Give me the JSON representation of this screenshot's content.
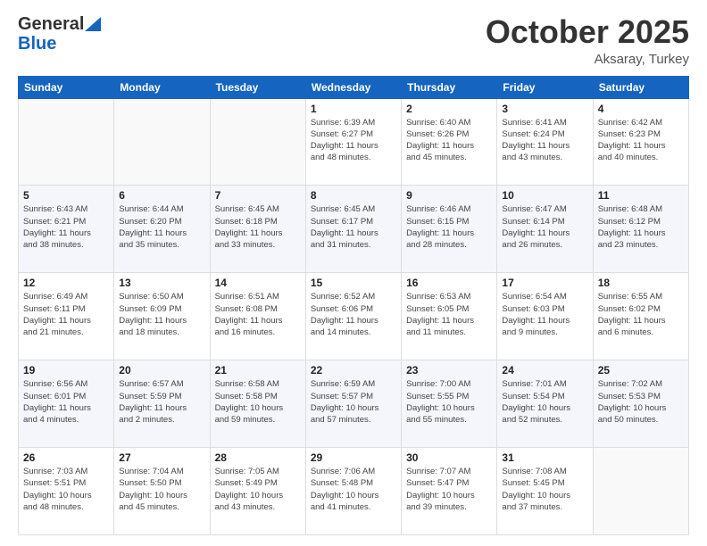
{
  "header": {
    "logo_general": "General",
    "logo_blue": "Blue",
    "month": "October 2025",
    "location": "Aksaray, Turkey"
  },
  "weekdays": [
    "Sunday",
    "Monday",
    "Tuesday",
    "Wednesday",
    "Thursday",
    "Friday",
    "Saturday"
  ],
  "weeks": [
    [
      {
        "day": "",
        "info": ""
      },
      {
        "day": "",
        "info": ""
      },
      {
        "day": "",
        "info": ""
      },
      {
        "day": "1",
        "info": "Sunrise: 6:39 AM\nSunset: 6:27 PM\nDaylight: 11 hours\nand 48 minutes."
      },
      {
        "day": "2",
        "info": "Sunrise: 6:40 AM\nSunset: 6:26 PM\nDaylight: 11 hours\nand 45 minutes."
      },
      {
        "day": "3",
        "info": "Sunrise: 6:41 AM\nSunset: 6:24 PM\nDaylight: 11 hours\nand 43 minutes."
      },
      {
        "day": "4",
        "info": "Sunrise: 6:42 AM\nSunset: 6:23 PM\nDaylight: 11 hours\nand 40 minutes."
      }
    ],
    [
      {
        "day": "5",
        "info": "Sunrise: 6:43 AM\nSunset: 6:21 PM\nDaylight: 11 hours\nand 38 minutes."
      },
      {
        "day": "6",
        "info": "Sunrise: 6:44 AM\nSunset: 6:20 PM\nDaylight: 11 hours\nand 35 minutes."
      },
      {
        "day": "7",
        "info": "Sunrise: 6:45 AM\nSunset: 6:18 PM\nDaylight: 11 hours\nand 33 minutes."
      },
      {
        "day": "8",
        "info": "Sunrise: 6:45 AM\nSunset: 6:17 PM\nDaylight: 11 hours\nand 31 minutes."
      },
      {
        "day": "9",
        "info": "Sunrise: 6:46 AM\nSunset: 6:15 PM\nDaylight: 11 hours\nand 28 minutes."
      },
      {
        "day": "10",
        "info": "Sunrise: 6:47 AM\nSunset: 6:14 PM\nDaylight: 11 hours\nand 26 minutes."
      },
      {
        "day": "11",
        "info": "Sunrise: 6:48 AM\nSunset: 6:12 PM\nDaylight: 11 hours\nand 23 minutes."
      }
    ],
    [
      {
        "day": "12",
        "info": "Sunrise: 6:49 AM\nSunset: 6:11 PM\nDaylight: 11 hours\nand 21 minutes."
      },
      {
        "day": "13",
        "info": "Sunrise: 6:50 AM\nSunset: 6:09 PM\nDaylight: 11 hours\nand 18 minutes."
      },
      {
        "day": "14",
        "info": "Sunrise: 6:51 AM\nSunset: 6:08 PM\nDaylight: 11 hours\nand 16 minutes."
      },
      {
        "day": "15",
        "info": "Sunrise: 6:52 AM\nSunset: 6:06 PM\nDaylight: 11 hours\nand 14 minutes."
      },
      {
        "day": "16",
        "info": "Sunrise: 6:53 AM\nSunset: 6:05 PM\nDaylight: 11 hours\nand 11 minutes."
      },
      {
        "day": "17",
        "info": "Sunrise: 6:54 AM\nSunset: 6:03 PM\nDaylight: 11 hours\nand 9 minutes."
      },
      {
        "day": "18",
        "info": "Sunrise: 6:55 AM\nSunset: 6:02 PM\nDaylight: 11 hours\nand 6 minutes."
      }
    ],
    [
      {
        "day": "19",
        "info": "Sunrise: 6:56 AM\nSunset: 6:01 PM\nDaylight: 11 hours\nand 4 minutes."
      },
      {
        "day": "20",
        "info": "Sunrise: 6:57 AM\nSunset: 5:59 PM\nDaylight: 11 hours\nand 2 minutes."
      },
      {
        "day": "21",
        "info": "Sunrise: 6:58 AM\nSunset: 5:58 PM\nDaylight: 10 hours\nand 59 minutes."
      },
      {
        "day": "22",
        "info": "Sunrise: 6:59 AM\nSunset: 5:57 PM\nDaylight: 10 hours\nand 57 minutes."
      },
      {
        "day": "23",
        "info": "Sunrise: 7:00 AM\nSunset: 5:55 PM\nDaylight: 10 hours\nand 55 minutes."
      },
      {
        "day": "24",
        "info": "Sunrise: 7:01 AM\nSunset: 5:54 PM\nDaylight: 10 hours\nand 52 minutes."
      },
      {
        "day": "25",
        "info": "Sunrise: 7:02 AM\nSunset: 5:53 PM\nDaylight: 10 hours\nand 50 minutes."
      }
    ],
    [
      {
        "day": "26",
        "info": "Sunrise: 7:03 AM\nSunset: 5:51 PM\nDaylight: 10 hours\nand 48 minutes."
      },
      {
        "day": "27",
        "info": "Sunrise: 7:04 AM\nSunset: 5:50 PM\nDaylight: 10 hours\nand 45 minutes."
      },
      {
        "day": "28",
        "info": "Sunrise: 7:05 AM\nSunset: 5:49 PM\nDaylight: 10 hours\nand 43 minutes."
      },
      {
        "day": "29",
        "info": "Sunrise: 7:06 AM\nSunset: 5:48 PM\nDaylight: 10 hours\nand 41 minutes."
      },
      {
        "day": "30",
        "info": "Sunrise: 7:07 AM\nSunset: 5:47 PM\nDaylight: 10 hours\nand 39 minutes."
      },
      {
        "day": "31",
        "info": "Sunrise: 7:08 AM\nSunset: 5:45 PM\nDaylight: 10 hours\nand 37 minutes."
      },
      {
        "day": "",
        "info": ""
      }
    ]
  ]
}
